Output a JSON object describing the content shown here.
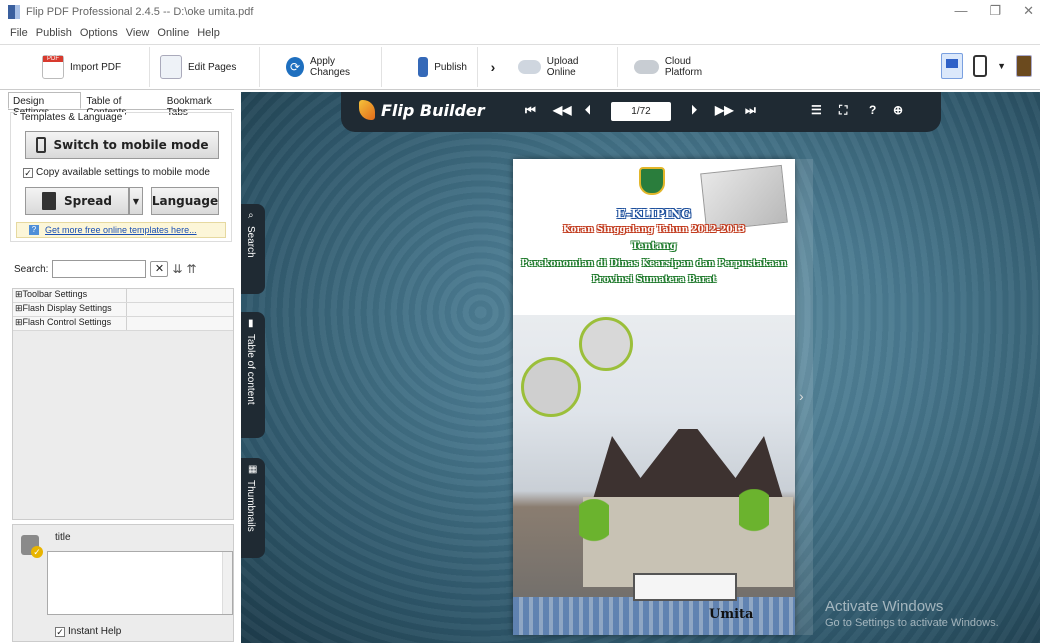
{
  "window": {
    "title": "Flip PDF Professional 2.4.5 -- D:\\oke umita.pdf"
  },
  "menu": [
    "File",
    "Publish",
    "Options",
    "View",
    "Online",
    "Help"
  ],
  "toolbar": {
    "import_pdf": "Import PDF",
    "edit_pages": "Edit Pages",
    "apply_changes": "Apply Changes",
    "publish": "Publish",
    "upload_online": "Upload Online",
    "cloud_platform": "Cloud Platform"
  },
  "left_panel": {
    "tabs": [
      "Design Settings",
      "Table of Contents",
      "Bookmark Tabs"
    ],
    "group_title": "Templates & Language",
    "switch_mobile": "Switch to mobile mode",
    "copy_settings": "Copy available settings to mobile mode",
    "spread": "Spread",
    "language": "Language",
    "templates_link": "Get more free online templates here...",
    "search_label": "Search:",
    "search_value": "",
    "tree": [
      "⊞Toolbar Settings",
      "⊞Flash Display Settings",
      "⊞Flash Control Settings"
    ],
    "prop_title": "title",
    "instant_help": "Instant Help"
  },
  "viewer": {
    "brand": "Flip Builder",
    "page_indicator": "1/72",
    "side_tabs": [
      "Search",
      "Table of content",
      "Thumbnails"
    ]
  },
  "cover": {
    "line1": "E-KLIPING",
    "line2": "Koran Singgalang Tahun 2012-2013",
    "line3": "Tentang",
    "line4": "Perekonomian di Dinas Kearsipan dan Perpustakaan",
    "line5": "Provinsi Sumatera Barat",
    "author": "Umita"
  },
  "watermark": {
    "line1": "Activate Windows",
    "line2": "Go to Settings to activate Windows."
  }
}
